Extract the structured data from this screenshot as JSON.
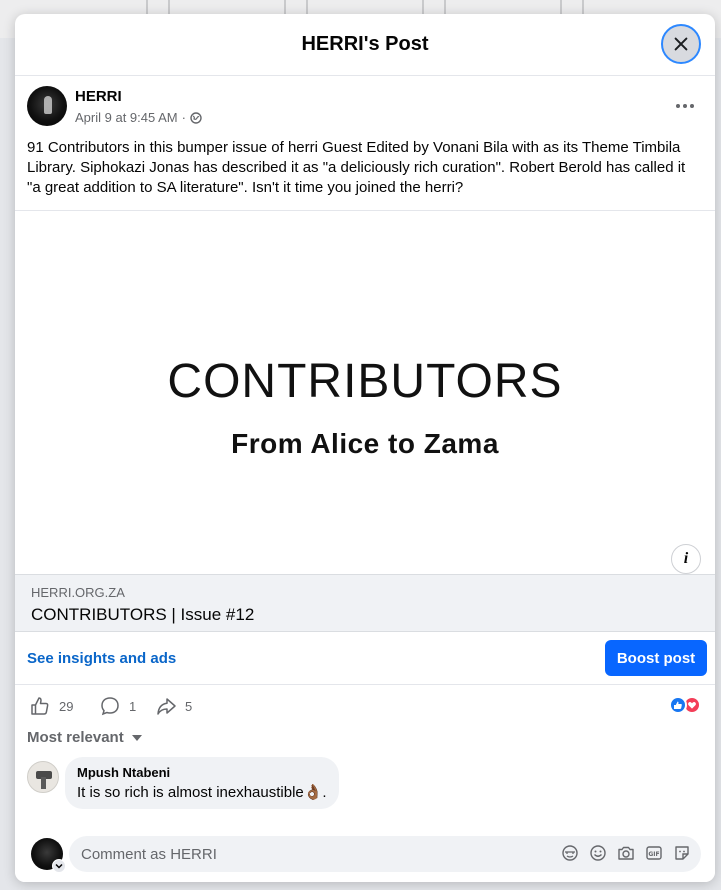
{
  "modal": {
    "title": "HERRI's Post"
  },
  "post": {
    "page_name": "HERRI",
    "date": "April 9 at 9:45 AM",
    "separator": "·",
    "text": "91 Contributors in this bumper issue of herri Guest Edited by Vonani Bila with as its Theme Timbila Library. Siphokazi Jonas has described it as \"a deliciously rich curation\". Robert Berold has called it \"a great addition to SA literature\". Isn't it time you joined the herri?",
    "image": {
      "title": "CONTRIBUTORS",
      "subtitle": "From Alice to Zama"
    },
    "link": {
      "domain": "HERRI.ORG.ZA",
      "title": "CONTRIBUTORS | Issue #12"
    }
  },
  "insights": {
    "link_label": "See insights and ads",
    "boost_label": "Boost post"
  },
  "actions": {
    "likes": "29",
    "comments": "1",
    "shares": "5"
  },
  "comments": {
    "sort_label": "Most relevant",
    "items": [
      {
        "author": "Mpush Ntabeni",
        "text": "It is so rich is almost inexhaustible👌🏾."
      }
    ]
  },
  "composer": {
    "placeholder": "Comment as HERRI"
  },
  "colors": {
    "accent": "#0866ff",
    "link": "#0a66c9",
    "like": "#1877f2",
    "love": "#f33e58"
  },
  "icons": [
    "close-icon",
    "globe-icon",
    "more-icon",
    "info-icon",
    "like-icon",
    "comment-icon",
    "share-icon",
    "sticker-icon",
    "emoji-icon",
    "camera-icon",
    "gif-icon",
    "avatar-sticker-icon"
  ]
}
